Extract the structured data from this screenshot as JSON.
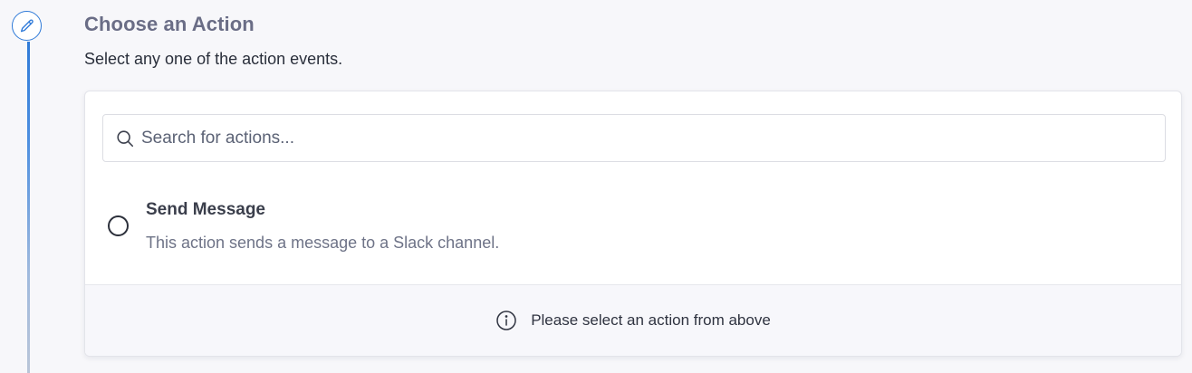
{
  "step": {
    "title": "Choose an Action",
    "subtitle": "Select any one of the action events.",
    "icon": "pencil-icon"
  },
  "search": {
    "placeholder": "Search for actions...",
    "value": "",
    "icon": "search-icon"
  },
  "actions": [
    {
      "title": "Send Message",
      "description": "This action sends a message to a Slack channel.",
      "selected": false
    }
  ],
  "footer": {
    "message": "Please select an action from above",
    "icon": "info-icon"
  },
  "colors": {
    "accent": "#2f7ad8",
    "title": "#6a6d86",
    "background": "#f7f7fa"
  }
}
